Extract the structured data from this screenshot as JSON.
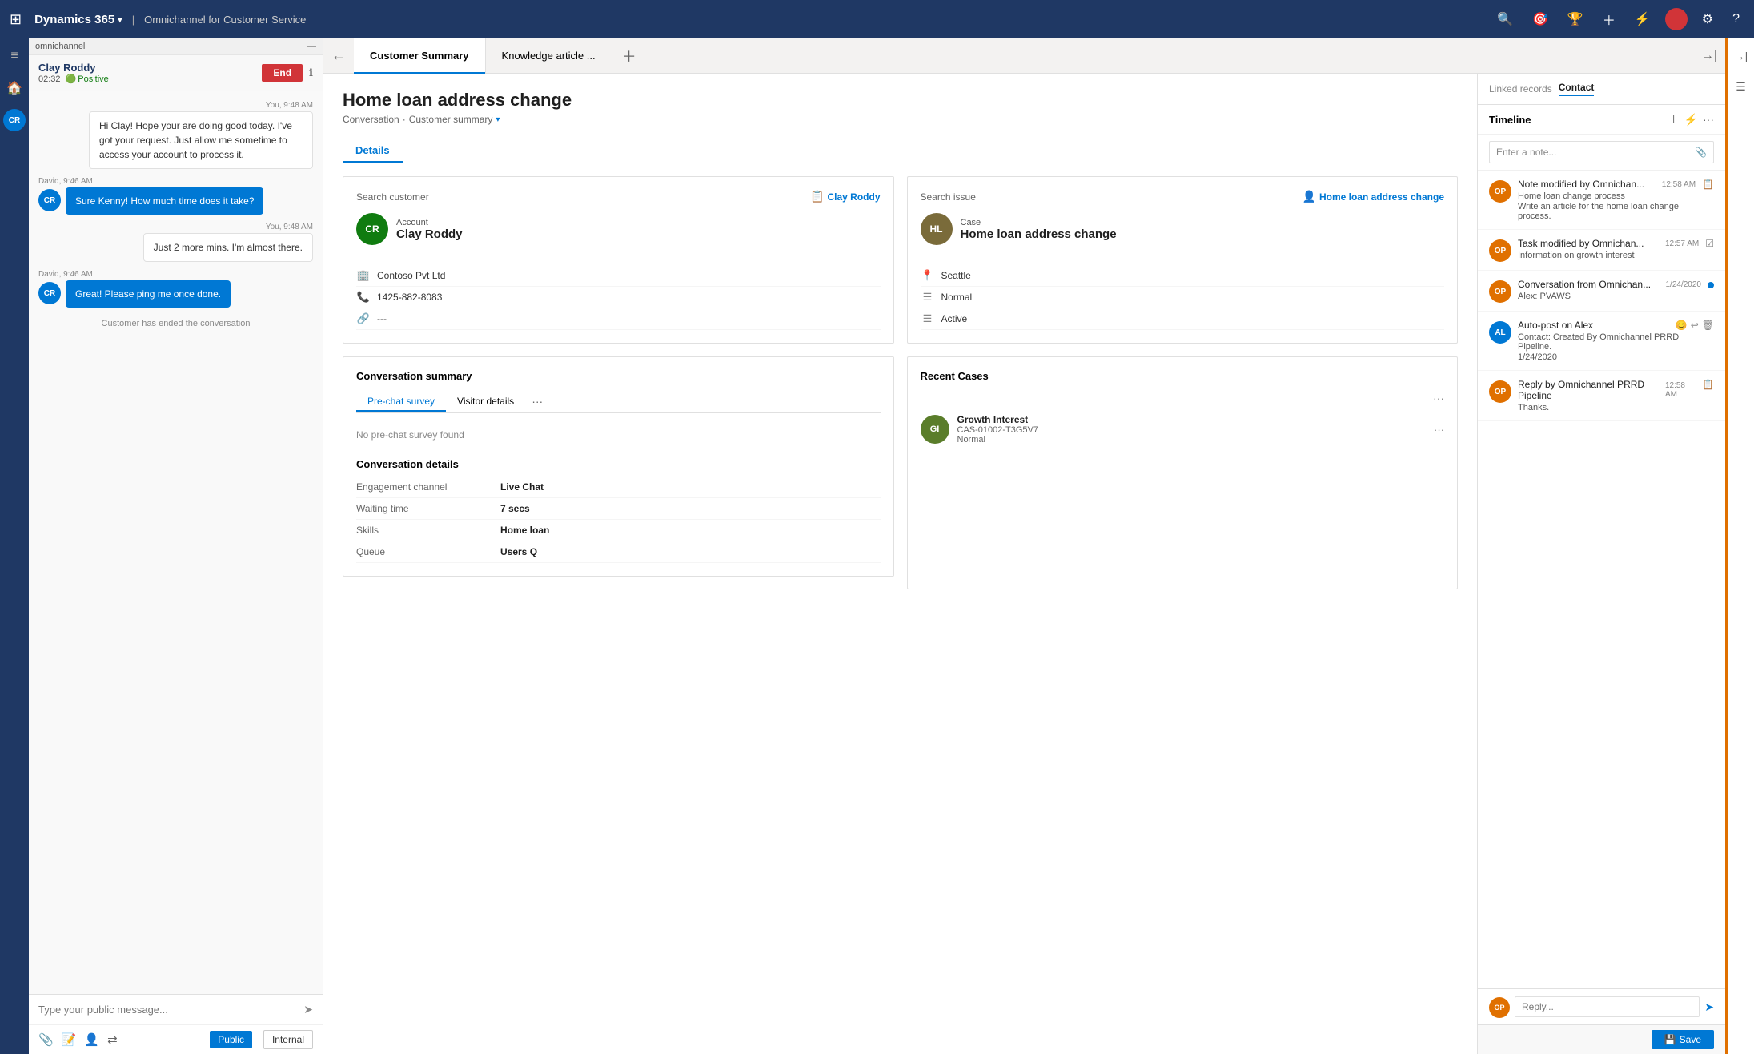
{
  "topNav": {
    "waffle": "⊞",
    "brand": "Dynamics 365",
    "brandChevron": "▾",
    "appName": "Omnichannel for Customer Service",
    "icons": [
      "🔍",
      "🎯",
      "🏆",
      "＋",
      "⚡",
      "🔴",
      "⚙",
      "?"
    ]
  },
  "leftSidebar": {
    "icons": [
      "≡",
      "🏠",
      "💬"
    ]
  },
  "chat": {
    "customerName": "Clay Roddy",
    "timer": "02:32",
    "sentiment": "Positive",
    "endBtn": "End",
    "subheader": "omnichannel",
    "messages": [
      {
        "type": "agent",
        "time": "You, 9:48 AM",
        "text": "Hi Clay! Hope your are doing good today. I've got your request. Just allow me sometime to access your account to process it."
      },
      {
        "type": "customer",
        "initials": "CR",
        "sender": "David, 9:46 AM",
        "text": "Sure Kenny! How much time does it take?"
      },
      {
        "type": "agent",
        "time": "You, 9:48 AM",
        "text": "Just 2 more mins. I'm almost there."
      },
      {
        "type": "customer",
        "initials": "CR",
        "sender": "David, 9:46 AM",
        "text": "Great! Please ping me once done."
      }
    ],
    "systemMsg": "Customer has ended the conversation",
    "inputPlaceholder": "Type your public message...",
    "publicBtn": "Public",
    "internalBtn": "Internal"
  },
  "tabs": [
    {
      "label": "Customer Summary",
      "active": true
    },
    {
      "label": "Knowledge article ...",
      "active": false
    }
  ],
  "pageTitle": "Home loan address change",
  "breadcrumb": [
    "Conversation",
    "·",
    "Customer summary"
  ],
  "detailTabs": [
    {
      "label": "Details",
      "active": true
    }
  ],
  "customerCard": {
    "searchLabel": "Search customer",
    "searchLink": "Clay Roddy",
    "initials": "CR",
    "account": "Account",
    "name": "Clay Roddy",
    "company": "Contoso Pvt Ltd",
    "phone": "1425-882-8083",
    "extra": "---"
  },
  "issueCard": {
    "searchLabel": "Search issue",
    "searchLink": "Home loan address change",
    "initials": "HL",
    "caseLabel": "Case",
    "caseName": "Home loan address change",
    "location": "Seattle",
    "priority": "Normal",
    "status": "Active"
  },
  "conversationSummary": {
    "title": "Conversation summary",
    "tabs": [
      {
        "label": "Pre-chat survey",
        "active": true
      },
      {
        "label": "Visitor details",
        "active": false
      }
    ],
    "noSurvey": "No pre-chat survey found",
    "detailsTitle": "Conversation details",
    "details": [
      {
        "label": "Engagement channel",
        "value": "Live Chat"
      },
      {
        "label": "Waiting time",
        "value": "7 secs"
      },
      {
        "label": "Skills",
        "value": "Home loan"
      },
      {
        "label": "Queue",
        "value": "Users Q"
      }
    ]
  },
  "recentCases": {
    "title": "Recent Cases",
    "cases": [
      {
        "initials": "GI",
        "name": "Growth Interest",
        "id": "CAS-01002-T3G5V7",
        "priority": "Normal"
      }
    ]
  },
  "linkedRecords": {
    "tabs": [
      "Linked records",
      "Contact"
    ],
    "activeTab": "Contact"
  },
  "timeline": {
    "title": "Timeline",
    "items": [
      {
        "initials": "OP",
        "color": "#e07000",
        "title": "Note modified by Omnichan...",
        "time": "12:58 AM",
        "sub1": "Home loan change process",
        "sub2": "Write an article for the home loan change process.",
        "hasDot": false,
        "icons": [
          "📋"
        ]
      },
      {
        "initials": "OP",
        "color": "#e07000",
        "title": "Task modified by Omnichan...",
        "time": "12:57 AM",
        "sub1": "Information on growth interest",
        "sub2": "",
        "hasDot": false,
        "icons": [
          "☑"
        ]
      },
      {
        "initials": "OP",
        "color": "#e07000",
        "title": "Conversation from Omnichan...",
        "time": "1/24/2020",
        "sub1": "Alex: PVAWS",
        "sub2": "",
        "hasDot": true,
        "icons": []
      },
      {
        "initials": "AL",
        "color": "#0078d4",
        "title": "Auto-post on Alex",
        "time": "",
        "sub1": "Contact: Created By Omnichannel PRRD Pipeline.",
        "sub2": "1/24/2020",
        "hasDot": false,
        "icons": [
          "😊",
          "↩",
          "🗑"
        ]
      },
      {
        "initials": "OP",
        "color": "#e07000",
        "title": "Reply by Omnichannel PRRD Pipeline",
        "time": "12:58 AM",
        "sub1": "Thanks.",
        "sub2": "",
        "hasDot": false,
        "icons": [
          "📋"
        ]
      }
    ],
    "replyPlaceholder": "Reply..."
  },
  "saveBar": {
    "saveLabel": "Save"
  }
}
